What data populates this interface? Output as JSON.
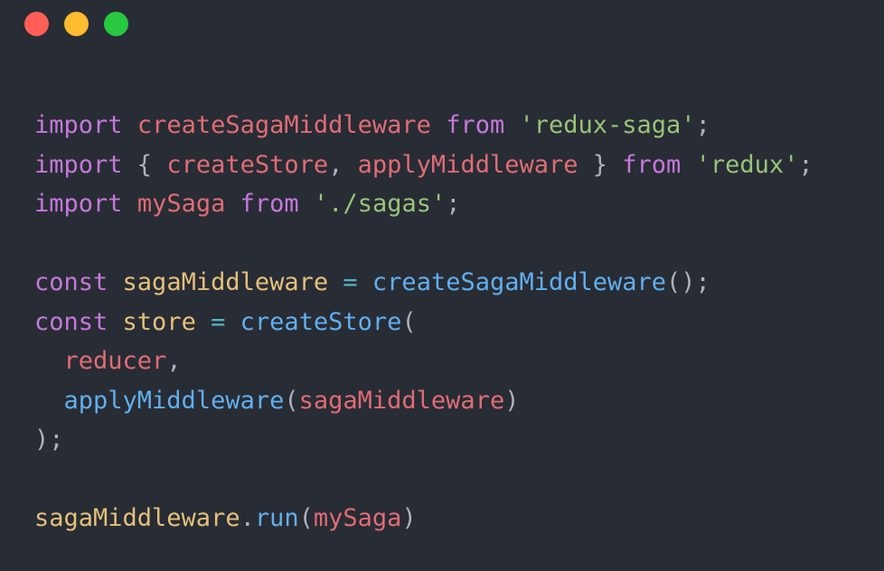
{
  "window": {
    "controls": [
      {
        "name": "close",
        "color": "#ff5f57"
      },
      {
        "name": "minimize",
        "color": "#febc2e"
      },
      {
        "name": "maximize",
        "color": "#28c840"
      }
    ]
  },
  "colors": {
    "background": "#282c34",
    "keyword": "#c678dd",
    "variable": "#e06c75",
    "string": "#98c379",
    "punctuation": "#abb2bf",
    "function": "#61afef",
    "const_name": "#e5c07b",
    "operator": "#56b6c2"
  },
  "code": {
    "lines": [
      [
        {
          "t": "import",
          "k": "keyword"
        },
        {
          "t": " ",
          "k": "punct"
        },
        {
          "t": "createSagaMiddleware",
          "k": "variable"
        },
        {
          "t": " ",
          "k": "punct"
        },
        {
          "t": "from",
          "k": "keyword"
        },
        {
          "t": " ",
          "k": "punct"
        },
        {
          "t": "'redux-saga'",
          "k": "string"
        },
        {
          "t": ";",
          "k": "punct"
        }
      ],
      [
        {
          "t": "import",
          "k": "keyword"
        },
        {
          "t": " { ",
          "k": "punct"
        },
        {
          "t": "createStore",
          "k": "variable"
        },
        {
          "t": ", ",
          "k": "punct"
        },
        {
          "t": "applyMiddleware",
          "k": "variable"
        },
        {
          "t": " } ",
          "k": "punct"
        },
        {
          "t": "from",
          "k": "keyword"
        },
        {
          "t": " ",
          "k": "punct"
        },
        {
          "t": "'redux'",
          "k": "string"
        },
        {
          "t": ";",
          "k": "punct"
        }
      ],
      [
        {
          "t": "import",
          "k": "keyword"
        },
        {
          "t": " ",
          "k": "punct"
        },
        {
          "t": "mySaga",
          "k": "variable"
        },
        {
          "t": " ",
          "k": "punct"
        },
        {
          "t": "from",
          "k": "keyword"
        },
        {
          "t": " ",
          "k": "punct"
        },
        {
          "t": "'./sagas'",
          "k": "string"
        },
        {
          "t": ";",
          "k": "punct"
        }
      ],
      [],
      [
        {
          "t": "const",
          "k": "keyword"
        },
        {
          "t": " ",
          "k": "punct"
        },
        {
          "t": "sagaMiddleware",
          "k": "const-name"
        },
        {
          "t": " ",
          "k": "punct"
        },
        {
          "t": "=",
          "k": "operator"
        },
        {
          "t": " ",
          "k": "punct"
        },
        {
          "t": "createSagaMiddleware",
          "k": "function"
        },
        {
          "t": "();",
          "k": "punct"
        }
      ],
      [
        {
          "t": "const",
          "k": "keyword"
        },
        {
          "t": " ",
          "k": "punct"
        },
        {
          "t": "store",
          "k": "const-name"
        },
        {
          "t": " ",
          "k": "punct"
        },
        {
          "t": "=",
          "k": "operator"
        },
        {
          "t": " ",
          "k": "punct"
        },
        {
          "t": "createStore",
          "k": "function"
        },
        {
          "t": "(",
          "k": "punct"
        }
      ],
      [
        {
          "t": "  ",
          "k": "punct"
        },
        {
          "t": "reducer",
          "k": "variable"
        },
        {
          "t": ",",
          "k": "punct"
        }
      ],
      [
        {
          "t": "  ",
          "k": "punct"
        },
        {
          "t": "applyMiddleware",
          "k": "function"
        },
        {
          "t": "(",
          "k": "punct"
        },
        {
          "t": "sagaMiddleware",
          "k": "variable"
        },
        {
          "t": ")",
          "k": "punct"
        }
      ],
      [
        {
          "t": ");",
          "k": "punct"
        }
      ],
      [],
      [
        {
          "t": "sagaMiddleware",
          "k": "const-name"
        },
        {
          "t": ".",
          "k": "punct"
        },
        {
          "t": "run",
          "k": "function"
        },
        {
          "t": "(",
          "k": "punct"
        },
        {
          "t": "mySaga",
          "k": "variable"
        },
        {
          "t": ")",
          "k": "punct"
        }
      ]
    ]
  }
}
